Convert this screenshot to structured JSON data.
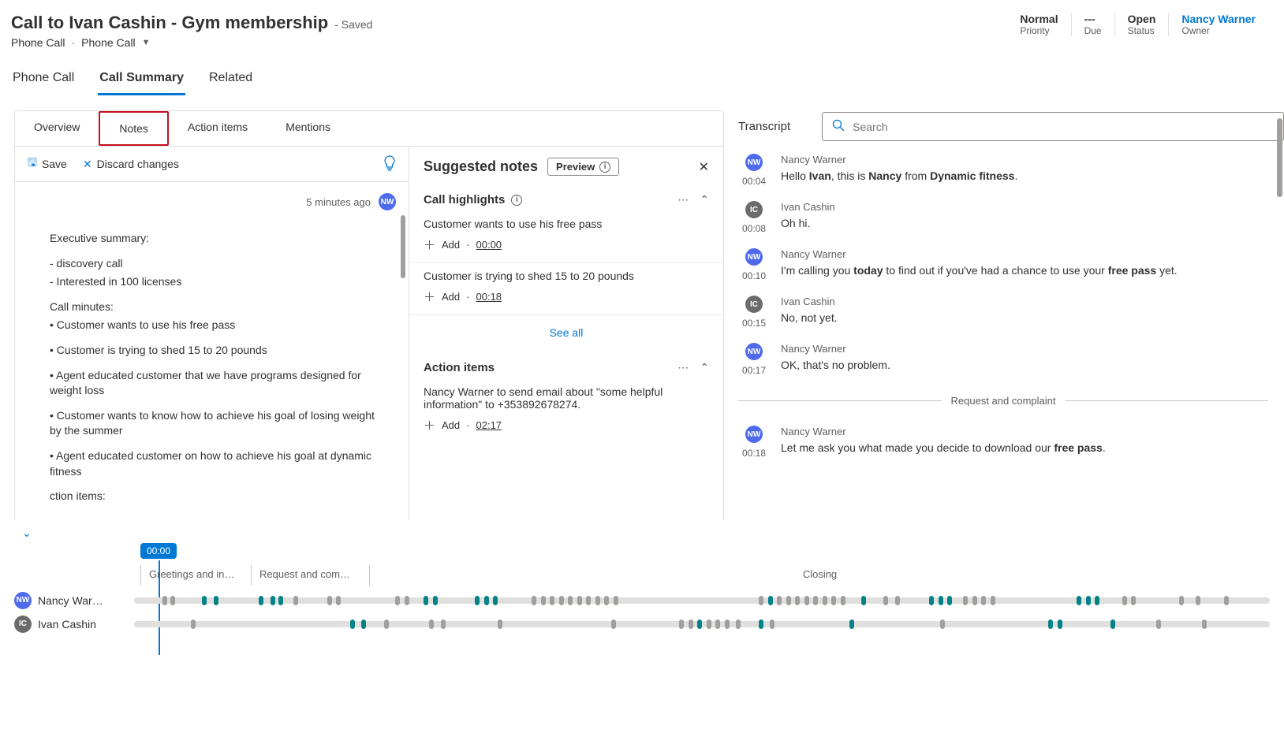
{
  "header": {
    "title": "Call to Ivan Cashin - Gym membership",
    "saved": "- Saved",
    "subtitle1": "Phone Call",
    "subtitle2": "Phone Call",
    "meta": [
      {
        "value": "Normal",
        "label": "Priority"
      },
      {
        "value": "---",
        "label": "Due"
      },
      {
        "value": "Open",
        "label": "Status"
      },
      {
        "value": "Nancy Warner",
        "label": "Owner",
        "link": true
      }
    ]
  },
  "mainTabs": {
    "t0": "Phone Call",
    "t1": "Call Summary",
    "t2": "Related"
  },
  "subTabs": {
    "t0": "Overview",
    "t1": "Notes",
    "t2": "Action items",
    "t3": "Mentions"
  },
  "toolbar": {
    "save": "Save",
    "discard": "Discard changes"
  },
  "notesMeta": {
    "ago": "5 minutes ago",
    "initials": "NW"
  },
  "notes": {
    "h0": "Executive summary:",
    "l0": "- discovery call",
    "l1": "- Interested in 100 licenses",
    "h1": "Call minutes:",
    "b0": "• Customer wants to use his free pass",
    "b1": "• Customer is trying to shed 15 to 20 pounds",
    "b2": "• Agent educated customer that we have programs designed for weight loss",
    "b3": "• Customer wants to know how to achieve his goal of losing weight by the summer",
    "b4": "• Agent educated customer on how to achieve his goal at dynamic fitness",
    "h2": "ction items:"
  },
  "suggested": {
    "title": "Suggested notes",
    "preview": "Preview",
    "highlights": "Call highlights",
    "items": [
      {
        "text": "Customer wants to use his free pass",
        "ts": "00:00"
      },
      {
        "text": "Customer is trying to shed 15 to 20 pounds",
        "ts": "00:18"
      }
    ],
    "add": "Add",
    "seeAll": "See all",
    "actionItems": "Action items",
    "ai0": "Nancy Warner to send email about \"some helpful information\" to +353892678274.",
    "aiTs": "02:17"
  },
  "transcriptLabel": "Transcript",
  "searchPlaceholder": "Search",
  "transcript": [
    {
      "who": "Nancy Warner",
      "initials": "NW",
      "cls": "nw",
      "time": "00:04",
      "html": "Hello <b>Ivan</b>, this is <b>Nancy</b> from <b>Dynamic fitness</b>."
    },
    {
      "who": "Ivan Cashin",
      "initials": "IC",
      "cls": "ic",
      "time": "00:08",
      "html": "Oh hi."
    },
    {
      "who": "Nancy Warner",
      "initials": "NW",
      "cls": "nw",
      "time": "00:10",
      "html": "I'm calling you <b>today</b> to find out if you've had a chance to use your <b>free pass</b> yet."
    },
    {
      "who": "Ivan Cashin",
      "initials": "IC",
      "cls": "ic",
      "time": "00:15",
      "html": "No, not yet."
    },
    {
      "who": "Nancy Warner",
      "initials": "NW",
      "cls": "nw",
      "time": "00:17",
      "html": "OK, that's no problem."
    }
  ],
  "divider": "Request and complaint",
  "transcript2": [
    {
      "who": "Nancy Warner",
      "initials": "NW",
      "cls": "nw",
      "time": "00:18",
      "html": "Let me ask you what made you decide to download our <b>free pass</b>."
    }
  ],
  "playhead": "00:00",
  "segments": {
    "s0": "Greetings and in…",
    "s1": "Request and com…",
    "s2": "Closing"
  },
  "tracks": {
    "nw": {
      "name": "Nancy War…",
      "initials": "NW"
    },
    "ic": {
      "name": "Ivan Cashin",
      "initials": "IC"
    }
  }
}
